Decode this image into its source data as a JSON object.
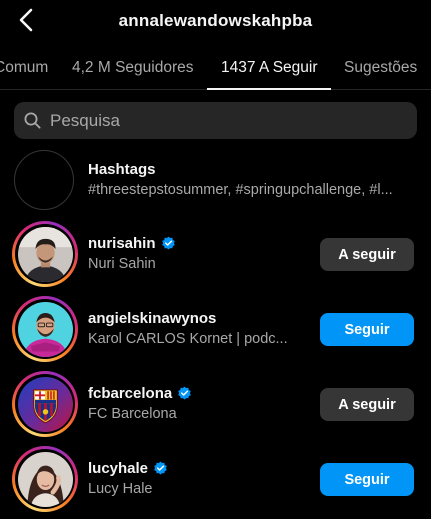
{
  "header": {
    "title": "annalewandowskahpba",
    "back_icon": "chevron-left-icon"
  },
  "tabs": [
    {
      "label": "Comum",
      "active": false
    },
    {
      "label": "4,2 M Seguidores",
      "active": false
    },
    {
      "label": "1437 A Seguir",
      "active": true
    },
    {
      "label": "Sugestões",
      "active": false
    }
  ],
  "search": {
    "placeholder": "Pesquisa",
    "icon": "search-icon"
  },
  "hashtags": {
    "title": "Hashtags",
    "subtitle": "#threestepstosummer, #springupchallenge, #l...",
    "icon": "hashtag-icon"
  },
  "users": [
    {
      "username": "nurisahin",
      "name": "Nuri Sahin",
      "verified": true,
      "button": "A seguir",
      "state": "following"
    },
    {
      "username": "angielskinawynos",
      "name": "Karol CARLOS Kornet | podc...",
      "verified": false,
      "button": "Seguir",
      "state": "follow"
    },
    {
      "username": "fcbarcelona",
      "name": "FC Barcelona",
      "verified": true,
      "button": "A seguir",
      "state": "following"
    },
    {
      "username": "lucyhale",
      "name": "Lucy Hale",
      "verified": true,
      "button": "Seguir",
      "state": "follow"
    }
  ],
  "colors": {
    "background": "#000000",
    "follow_button": "#0095f6",
    "following_button": "#363636",
    "verified": "#0095f6"
  }
}
